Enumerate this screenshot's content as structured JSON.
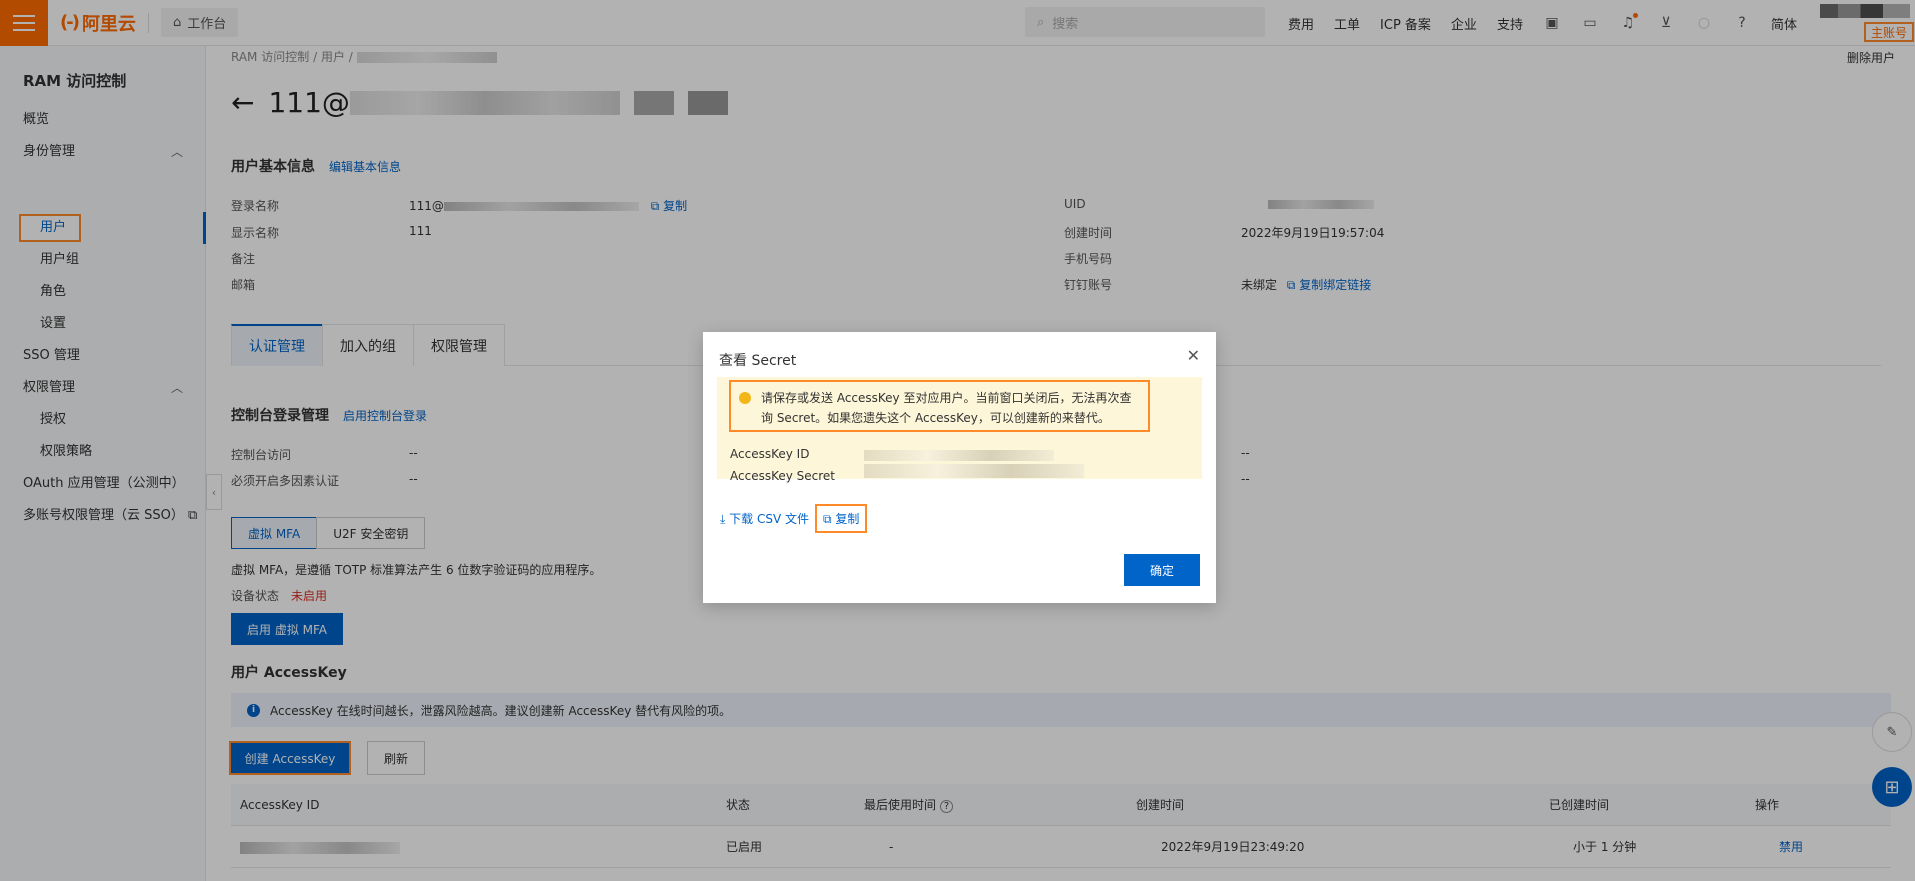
{
  "topbar": {
    "logo_text": "阿里云",
    "workbench": "工作台",
    "search_placeholder": "搜索",
    "nav": [
      "费用",
      "工单",
      "ICP 备案",
      "企业",
      "支持"
    ],
    "lang": "简体",
    "sub_account": "主账号"
  },
  "sidebar": {
    "title": "RAM 访问控制",
    "items": [
      {
        "label": "概览"
      },
      {
        "label": "身份管理"
      },
      {
        "label": "用户"
      },
      {
        "label": "用户组"
      },
      {
        "label": "角色"
      },
      {
        "label": "设置"
      },
      {
        "label": "SSO 管理"
      },
      {
        "label": "权限管理"
      },
      {
        "label": "授权"
      },
      {
        "label": "权限策略"
      },
      {
        "label": "OAuth 应用管理（公测中）"
      },
      {
        "label": "多账号权限管理（云 SSO）"
      }
    ]
  },
  "breadcrumb": {
    "root": "RAM 访问控制",
    "sep": "/",
    "users": "用户",
    "sep2": "/"
  },
  "header": {
    "title_prefix": "111@",
    "delete": "删除用户"
  },
  "basic": {
    "title": "用户基本信息",
    "edit": "编辑基本信息",
    "login_label": "登录名称",
    "login_value": "111@",
    "copy": "复制",
    "display_label": "显示名称",
    "display_value": "111",
    "remark_label": "备注",
    "email_label": "邮箱",
    "uid_label": "UID",
    "created_label": "创建时间",
    "created_value": "2022年9月19日19:57:04",
    "phone_label": "手机号码",
    "dingtalk_label": "钉钉账号",
    "dingtalk_value": "未绑定",
    "copy_bind": "复制绑定链接"
  },
  "tabs": [
    "认证管理",
    "加入的组",
    "权限管理"
  ],
  "console": {
    "title": "控制台登录管理",
    "enable": "启用控制台登录",
    "access_label": "控制台访问",
    "access_value": "--",
    "mfa_label": "必须开启多因素认证",
    "mfa_value": "--",
    "right_value1": "--",
    "right_value2": "--"
  },
  "mfa": {
    "tab_virtual": "虚拟 MFA",
    "tab_u2f": "U2F 安全密钥",
    "desc": "虚拟 MFA，是遵循 TOTP 标准算法产生 6 位数字验证码的应用程序。",
    "status_label": "设备状态",
    "status_value": "未启用",
    "enable_btn": "启用 虚拟 MFA"
  },
  "accesskey": {
    "title": "用户 AccessKey",
    "notice": "AccessKey 在线时间越长，泄露风险越高。建议创建新 AccessKey 替代有风险的项。",
    "create_btn": "创建 AccessKey",
    "refresh_btn": "刷新",
    "columns": [
      "AccessKey ID",
      "状态",
      "最后使用时间",
      "创建时间",
      "已创建时间",
      "操作"
    ],
    "rows": [
      {
        "status": "已启用",
        "last_used": "-",
        "created": "2022年9月19日23:49:20",
        "age": "小于 1 分钟",
        "action": "禁用"
      }
    ]
  },
  "modal": {
    "title": "查看 Secret",
    "warning": "请保存或发送 AccessKey 至对应用户。当前窗口关闭后，无法再次查询 Secret。如果您遗失这个 AccessKey，可以创建新的来替代。",
    "id_label": "AccessKey ID",
    "secret_label": "AccessKey Secret",
    "download": "下载 CSV 文件",
    "copy": "复制",
    "ok": "确定"
  },
  "colors": {
    "brand": "#ff6a00",
    "primary": "#0064c8",
    "highlight": "#ff8a2a",
    "danger": "#d93026"
  }
}
